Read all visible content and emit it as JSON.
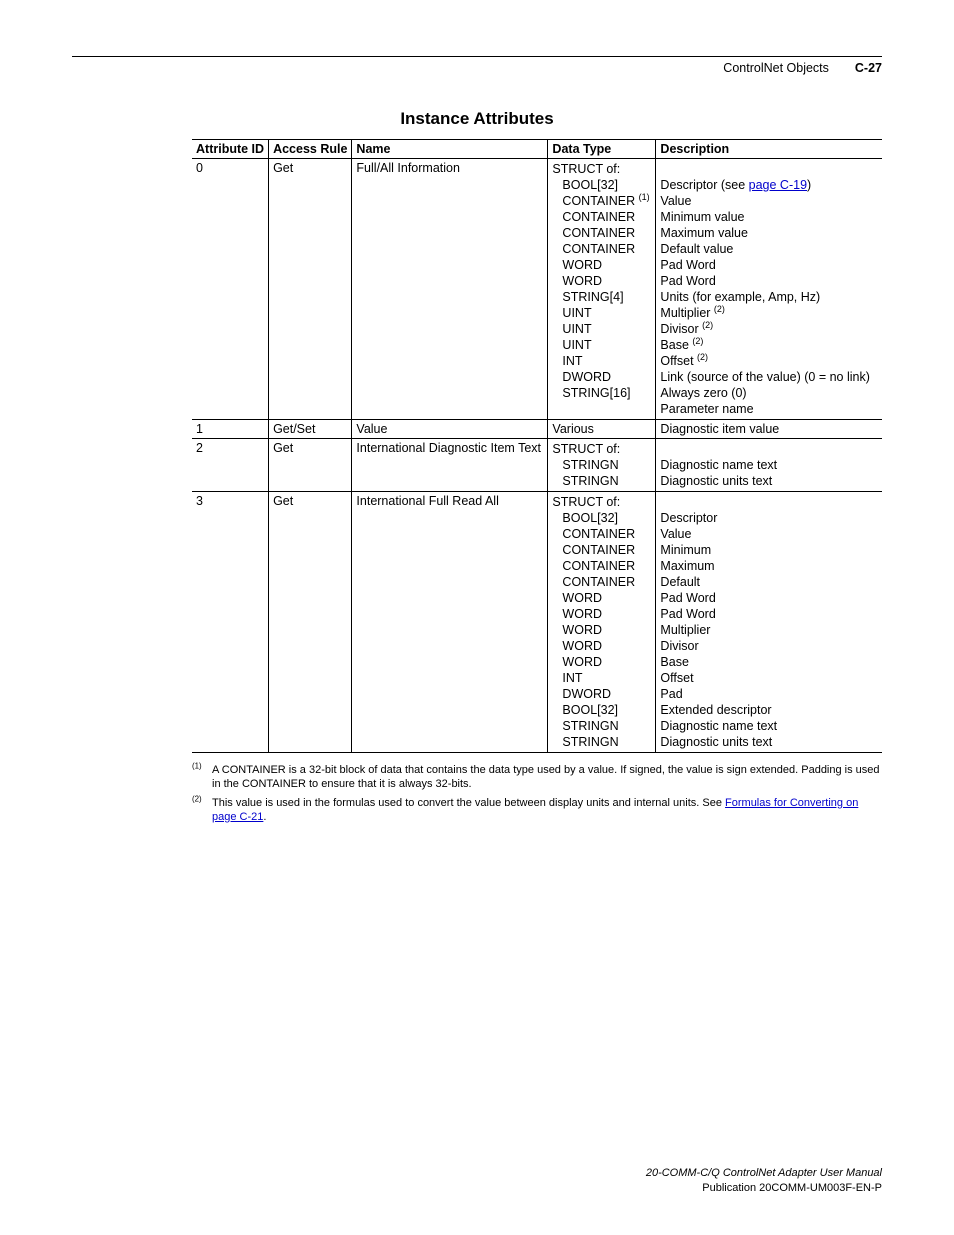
{
  "header": {
    "doc_section": "ControlNet Objects",
    "page_label": "C-27"
  },
  "section_title": "Instance Attributes",
  "columns": {
    "id": "Attribute ID",
    "access": "Access Rule",
    "name": "Name",
    "dtype": "Data Type",
    "desc": "Description"
  },
  "rows": {
    "r0": {
      "id": "0",
      "access": "Get",
      "name": "Full/All Information",
      "dtype_head": "STRUCT of:",
      "dtype": [
        "BOOL[32]",
        "CONTAINER ",
        "CONTAINER",
        "CONTAINER",
        "CONTAINER",
        "WORD",
        "WORD",
        "STRING[4]",
        "UINT",
        "UINT",
        "UINT",
        "INT",
        "DWORD",
        "STRING[16]"
      ],
      "dtype_sup": {
        "1": "(1)"
      },
      "desc": [
        "Descriptor (see ",
        ")",
        "Value",
        "Minimum value",
        "Maximum value",
        "Default value",
        "Pad Word",
        "Pad Word",
        "Units (for example, Amp, Hz)",
        "Multiplier ",
        "Divisor ",
        "Base ",
        "Offset ",
        "Link (source of the value) (0 = no link)",
        "Always zero (0)",
        "Parameter name"
      ],
      "desc_link": "page C-19",
      "desc_sup": {
        "9": "(2)",
        "10": "(2)",
        "11": "(2)",
        "12": "(2)"
      }
    },
    "r1": {
      "id": "1",
      "access": "Get/Set",
      "name": "Value",
      "dtype": "Various",
      "desc": "Diagnostic item value"
    },
    "r2": {
      "id": "2",
      "access": "Get",
      "name": "International Diagnostic Item Text",
      "dtype_head": "STRUCT of:",
      "dtype": [
        "STRINGN",
        "STRINGN"
      ],
      "desc": [
        "",
        "Diagnostic name text",
        "Diagnostic units text"
      ]
    },
    "r3": {
      "id": "3",
      "access": "Get",
      "name": "International Full Read All",
      "dtype_head": "STRUCT of:",
      "dtype": [
        "BOOL[32]",
        "CONTAINER",
        "CONTAINER",
        "CONTAINER",
        "CONTAINER",
        "WORD",
        "WORD",
        "WORD",
        "WORD",
        "WORD",
        "INT",
        "DWORD",
        "BOOL[32]",
        "STRINGN",
        "STRINGN"
      ],
      "desc": [
        "",
        "Descriptor",
        "Value",
        "Minimum",
        "Maximum",
        "Default",
        "Pad Word",
        "Pad Word",
        "Multiplier",
        "Divisor",
        "Base",
        "Offset",
        "Pad",
        "Extended descriptor",
        "Diagnostic name text",
        "Diagnostic units text"
      ]
    }
  },
  "footnotes": {
    "f1_num": "(1)",
    "f1": "A CONTAINER is a 32-bit block of data that contains the data type used by a value. If signed, the value is sign extended. Padding is used in the CONTAINER to ensure that it is always 32-bits.",
    "f2_num": "(2)",
    "f2_a": "This value is used in the formulas used to convert the value between display units and internal units. See ",
    "f2_link": "Formulas for Converting on page C-21",
    "f2_b": "."
  },
  "footer": {
    "manual": "20-COMM-C/Q ControlNet Adapter User Manual",
    "pub": "Publication 20COMM-UM003F-EN-P"
  }
}
